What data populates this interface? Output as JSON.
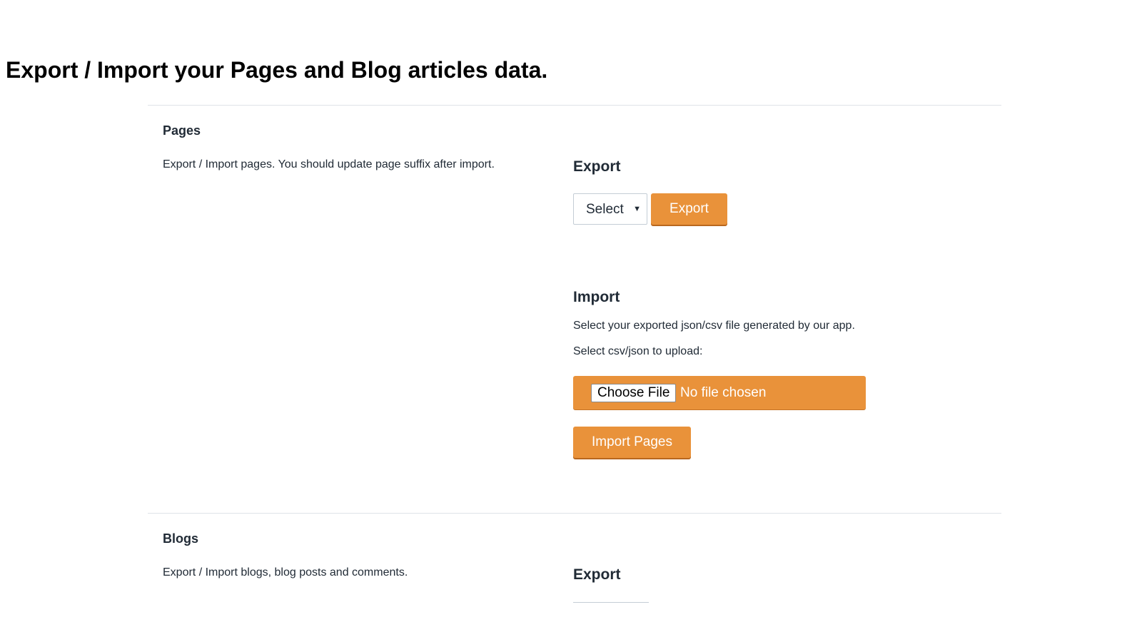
{
  "page": {
    "title": "Export / Import your Pages and Blog articles data."
  },
  "pages_section": {
    "heading": "Pages",
    "description": "Export / Import pages. You should update page suffix after import.",
    "export": {
      "heading": "Export",
      "select_value": "Select",
      "button_label": "Export"
    },
    "import": {
      "heading": "Import",
      "instruction": "Select your exported json/csv file generated by our app.",
      "file_label": "Select csv/json to upload:",
      "choose_file_label": "Choose File",
      "file_status": "No file chosen",
      "button_label": "Import Pages"
    }
  },
  "blogs_section": {
    "heading": "Blogs",
    "description": "Export / Import blogs, blog posts and comments.",
    "export": {
      "heading": "Export"
    }
  },
  "colors": {
    "accent": "#e9923a",
    "text": "#212b36",
    "divider": "#dfe3e8"
  },
  "icons": {
    "select_caret": "caret-down-icon"
  }
}
